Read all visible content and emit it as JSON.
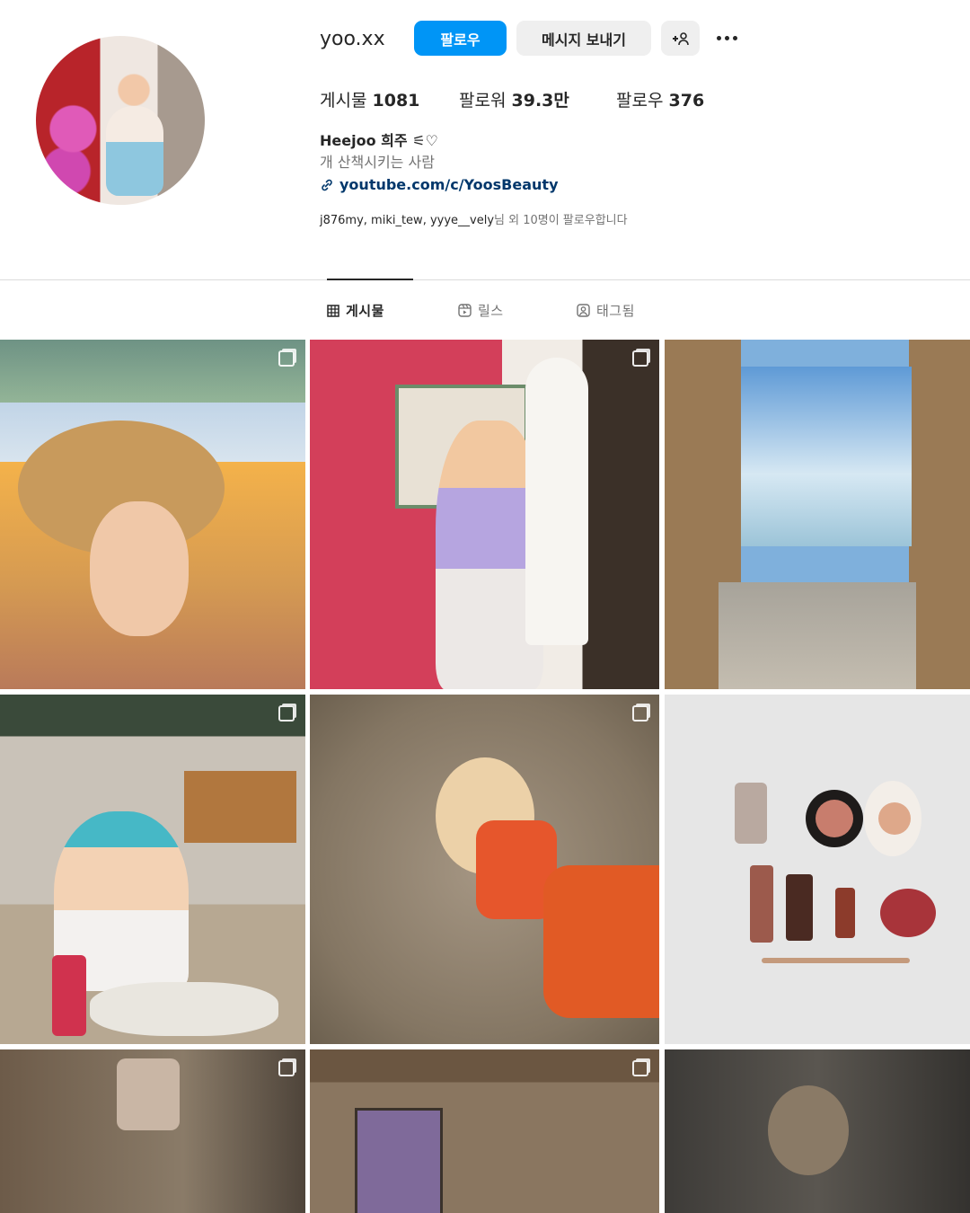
{
  "profile": {
    "username": "yoo.xx",
    "follow_label": "팔로우",
    "message_label": "메시지 보내기",
    "suggest_icon": "+person-icon",
    "more_icon": "more-dots-icon"
  },
  "stats": {
    "posts_label": "게시물",
    "posts_count": "1081",
    "followers_label": "팔로워",
    "followers_count": "39.3만",
    "following_label": "팔로우",
    "following_count": "376"
  },
  "bio": {
    "name": "Heejoo 희주 ⚟♡",
    "text": "개 산책시키는 사람",
    "link": "youtube.com/c/YoosBeauty"
  },
  "followed_by": {
    "names": "j876my, miki_tew, yyye__vely",
    "suffix": "님 외 10명이 팔로우합니다"
  },
  "tabs": [
    {
      "label": "게시물",
      "icon": "grid-icon",
      "active": true
    },
    {
      "label": "릴스",
      "icon": "reels-icon",
      "active": false
    },
    {
      "label": "태그됨",
      "icon": "tagged-icon",
      "active": false
    }
  ],
  "posts": [
    {
      "multi": true
    },
    {
      "multi": true
    },
    {
      "multi": false
    },
    {
      "multi": true
    },
    {
      "multi": true
    },
    {
      "multi": false
    },
    {
      "multi": true
    },
    {
      "multi": true
    },
    {
      "multi": false
    }
  ],
  "colors": {
    "primary": "#0095f6",
    "secondary_button": "#efefef",
    "link": "#00376b",
    "muted_text": "#737373",
    "divider": "#dbdbdb"
  }
}
